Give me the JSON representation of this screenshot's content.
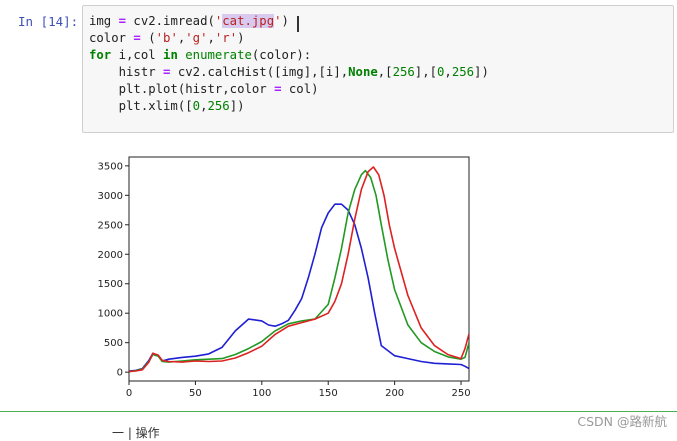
{
  "cell": {
    "prompt": "In [14]:",
    "lines": [
      [
        {
          "t": "img ",
          "c": ""
        },
        {
          "t": "=",
          "c": "op"
        },
        {
          "t": " cv2.imread(",
          "c": ""
        },
        {
          "t": "'",
          "c": "st"
        },
        {
          "t": "cat.jpg",
          "c": "st sel"
        },
        {
          "t": "'",
          "c": "st"
        },
        {
          "t": ")",
          "c": ""
        }
      ],
      [
        {
          "t": "color ",
          "c": ""
        },
        {
          "t": "=",
          "c": "op"
        },
        {
          "t": " (",
          "c": ""
        },
        {
          "t": "'b'",
          "c": "st"
        },
        {
          "t": ",",
          "c": ""
        },
        {
          "t": "'g'",
          "c": "st"
        },
        {
          "t": ",",
          "c": ""
        },
        {
          "t": "'r'",
          "c": "st"
        },
        {
          "t": ")",
          "c": ""
        }
      ],
      [
        {
          "t": "for",
          "c": "kw"
        },
        {
          "t": " i,col ",
          "c": ""
        },
        {
          "t": "in",
          "c": "kw"
        },
        {
          "t": " ",
          "c": ""
        },
        {
          "t": "enumerate",
          "c": "bi"
        },
        {
          "t": "(color):",
          "c": ""
        }
      ],
      [
        {
          "t": "    histr ",
          "c": ""
        },
        {
          "t": "=",
          "c": "op"
        },
        {
          "t": " cv2.calcHist([img],[i],",
          "c": ""
        },
        {
          "t": "None",
          "c": "kw"
        },
        {
          "t": ",[",
          "c": ""
        },
        {
          "t": "256",
          "c": "nm"
        },
        {
          "t": "],[",
          "c": ""
        },
        {
          "t": "0",
          "c": "nm"
        },
        {
          "t": ",",
          "c": ""
        },
        {
          "t": "256",
          "c": "nm"
        },
        {
          "t": "])",
          "c": ""
        }
      ],
      [
        {
          "t": "    plt.plot(histr,color ",
          "c": ""
        },
        {
          "t": "=",
          "c": "op"
        },
        {
          "t": " col)",
          "c": ""
        }
      ],
      [
        {
          "t": "    plt.xlim([",
          "c": ""
        },
        {
          "t": "0",
          "c": "nm"
        },
        {
          "t": ",",
          "c": ""
        },
        {
          "t": "256",
          "c": "nm"
        },
        {
          "t": "])",
          "c": ""
        }
      ]
    ]
  },
  "chart_data": {
    "type": "line",
    "xlim": [
      0,
      256
    ],
    "ylim": [
      -150,
      3650
    ],
    "xticks": [
      0,
      50,
      100,
      150,
      200,
      250
    ],
    "yticks": [
      0,
      500,
      1000,
      1500,
      2000,
      2500,
      3000,
      3500
    ],
    "series": [
      {
        "color": "#1f1fd4",
        "x": [
          0,
          5,
          10,
          15,
          18,
          22,
          25,
          30,
          40,
          50,
          60,
          70,
          80,
          90,
          100,
          105,
          110,
          115,
          120,
          125,
          130,
          135,
          140,
          145,
          150,
          155,
          160,
          165,
          170,
          175,
          180,
          185,
          190,
          200,
          210,
          220,
          230,
          240,
          250,
          253,
          256
        ],
        "y": [
          20,
          30,
          60,
          200,
          320,
          280,
          190,
          220,
          250,
          270,
          310,
          420,
          700,
          900,
          870,
          800,
          780,
          820,
          880,
          1050,
          1250,
          1600,
          2000,
          2450,
          2700,
          2850,
          2850,
          2750,
          2500,
          2100,
          1600,
          1000,
          450,
          280,
          230,
          180,
          150,
          140,
          130,
          100,
          60
        ]
      },
      {
        "color": "#229922",
        "x": [
          0,
          5,
          10,
          15,
          18,
          22,
          25,
          30,
          40,
          50,
          60,
          70,
          80,
          90,
          100,
          110,
          120,
          130,
          140,
          150,
          155,
          160,
          165,
          170,
          175,
          178,
          182,
          186,
          190,
          195,
          200,
          210,
          220,
          230,
          240,
          250,
          253,
          256
        ],
        "y": [
          10,
          25,
          50,
          180,
          300,
          270,
          180,
          170,
          190,
          210,
          220,
          230,
          300,
          400,
          520,
          700,
          820,
          870,
          900,
          1150,
          1600,
          2100,
          2700,
          3100,
          3350,
          3420,
          3300,
          3000,
          2500,
          1900,
          1400,
          800,
          500,
          350,
          260,
          220,
          250,
          500
        ]
      },
      {
        "color": "#dd2222",
        "x": [
          0,
          5,
          10,
          15,
          18,
          22,
          25,
          30,
          40,
          50,
          60,
          70,
          80,
          90,
          100,
          110,
          120,
          130,
          140,
          150,
          155,
          160,
          165,
          170,
          175,
          180,
          184,
          188,
          192,
          196,
          200,
          210,
          220,
          230,
          240,
          250,
          253,
          256
        ],
        "y": [
          10,
          20,
          40,
          170,
          320,
          290,
          200,
          180,
          170,
          190,
          180,
          190,
          240,
          330,
          440,
          640,
          780,
          840,
          900,
          1000,
          1200,
          1500,
          2000,
          2600,
          3100,
          3400,
          3480,
          3350,
          3000,
          2500,
          2100,
          1300,
          750,
          450,
          300,
          230,
          400,
          650
        ]
      }
    ]
  },
  "footer": {
    "partial_text": "一 | 操作",
    "watermark": "CSDN @路新航"
  },
  "colors": {
    "divider": "#4caf50",
    "prompt": "#3f51b5"
  }
}
